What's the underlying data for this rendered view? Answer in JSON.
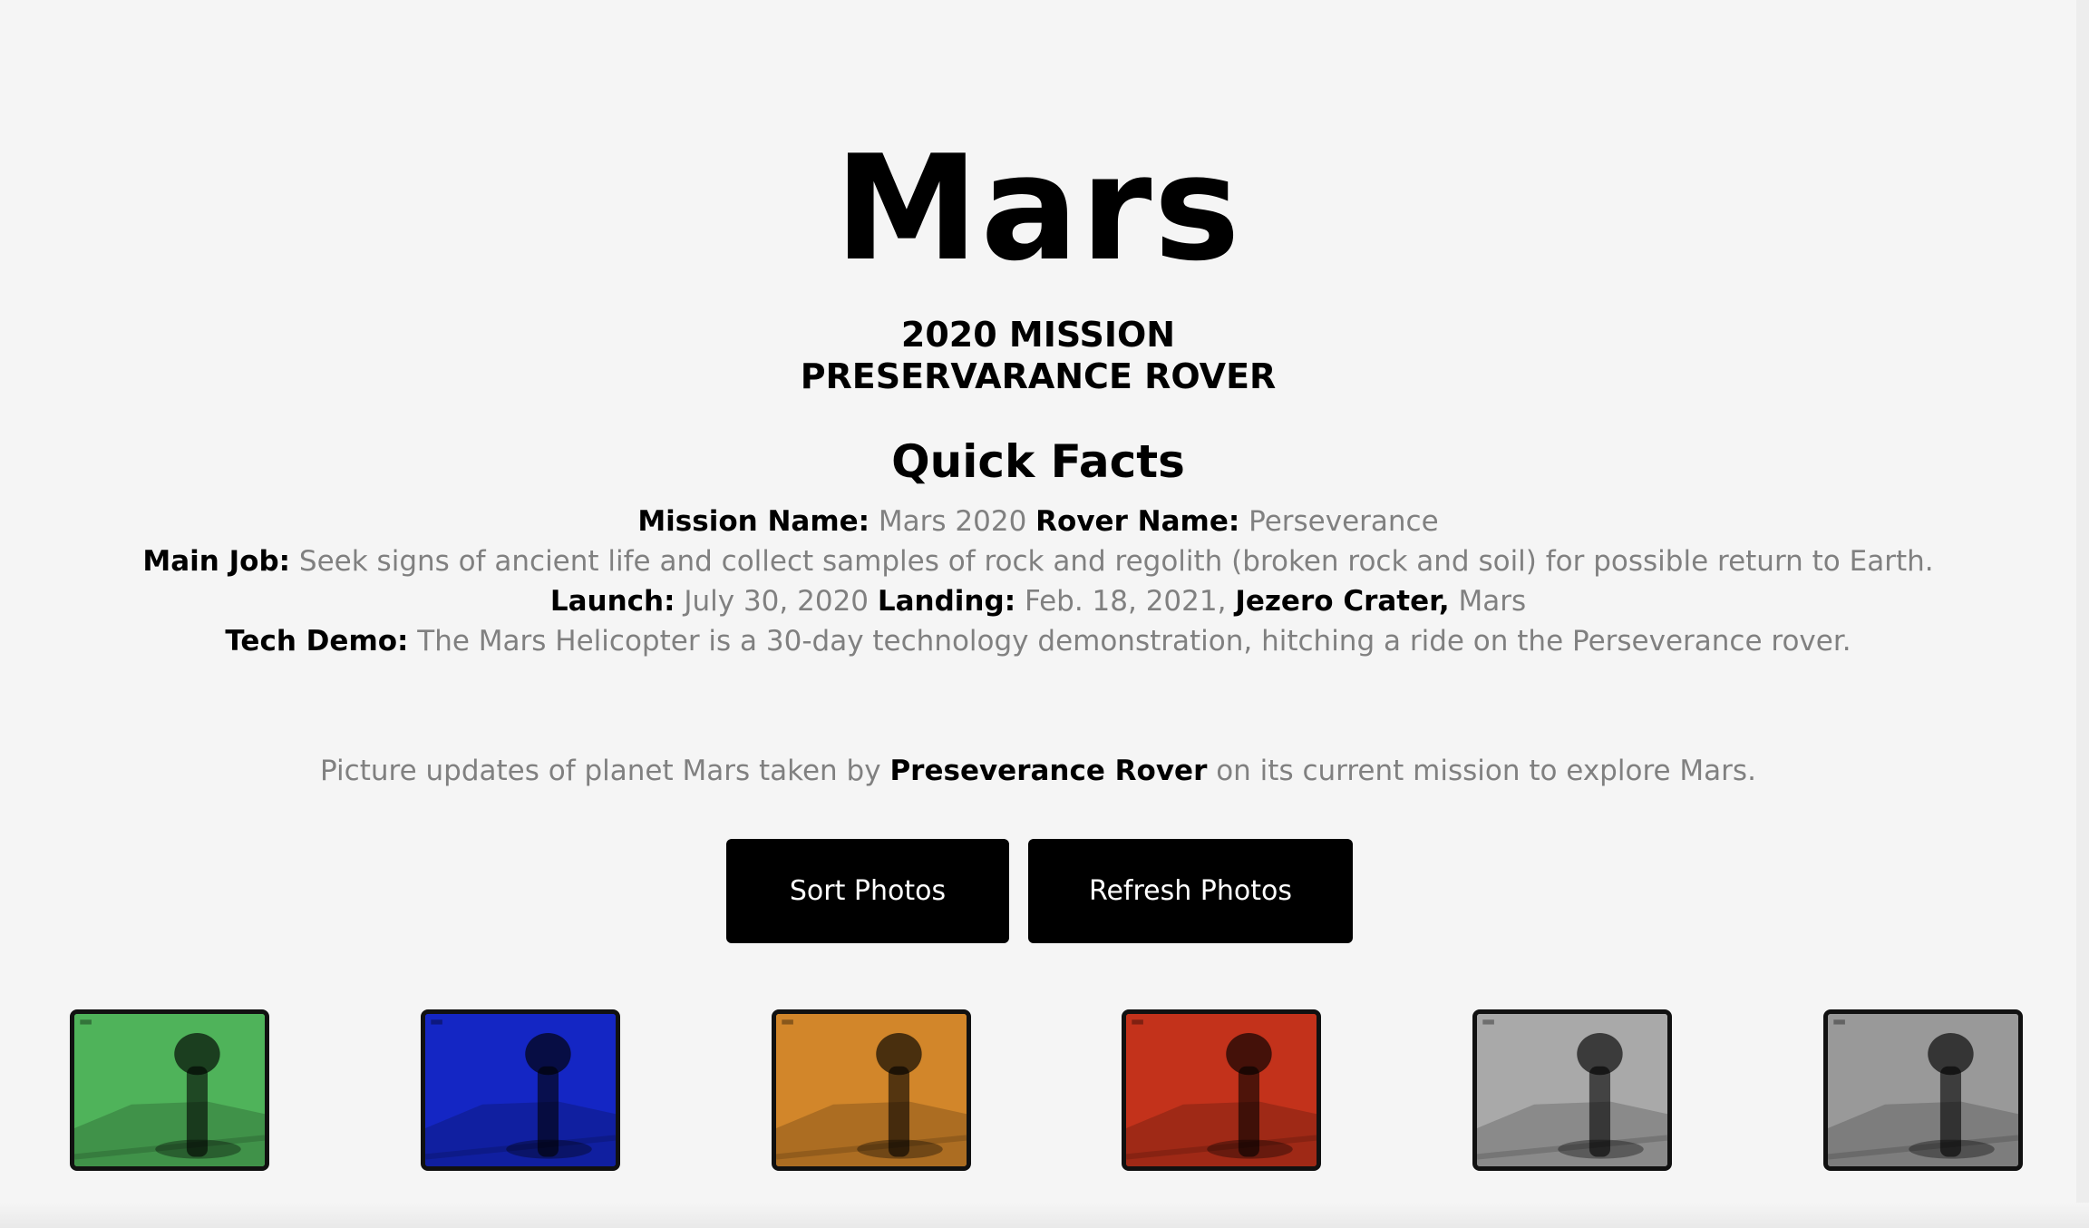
{
  "header": {
    "title": "Mars",
    "mission_line1": "2020 MISSION",
    "mission_line2": "PRESERVARANCE ROVER"
  },
  "facts": {
    "heading": "Quick Facts",
    "mission_name_label": "Mission Name:",
    "mission_name_value": "Mars 2020",
    "rover_name_label": "Rover Name:",
    "rover_name_value": "Perseverance",
    "main_job_label": "Main Job:",
    "main_job_value": "Seek signs of ancient life and collect samples of rock and regolith (broken rock and soil) for possible return to Earth.",
    "launch_label": "Launch:",
    "launch_value": "July 30, 2020",
    "landing_label": "Landing:",
    "landing_value": "Feb. 18, 2021,",
    "landing_site": "Jezero Crater,",
    "landing_planet": "Mars",
    "tech_demo_label": "Tech Demo:",
    "tech_demo_value": "The Mars Helicopter is a 30-day technology demonstration, hitching a ride on the Perseverance rover."
  },
  "intro": {
    "before": "Picture updates of planet Mars taken by",
    "rover": "Preseverance Rover",
    "after": "on its current mission to explore Mars."
  },
  "buttons": {
    "sort_label": "Sort Photos",
    "refresh_label": "Refresh Photos"
  },
  "photos": [
    {
      "tint": "#4fb35a"
    },
    {
      "tint": "#1426c4"
    },
    {
      "tint": "#d2862a"
    },
    {
      "tint": "#c3321b"
    },
    {
      "tint": "#a9a9a9"
    },
    {
      "tint": "#999999"
    }
  ]
}
